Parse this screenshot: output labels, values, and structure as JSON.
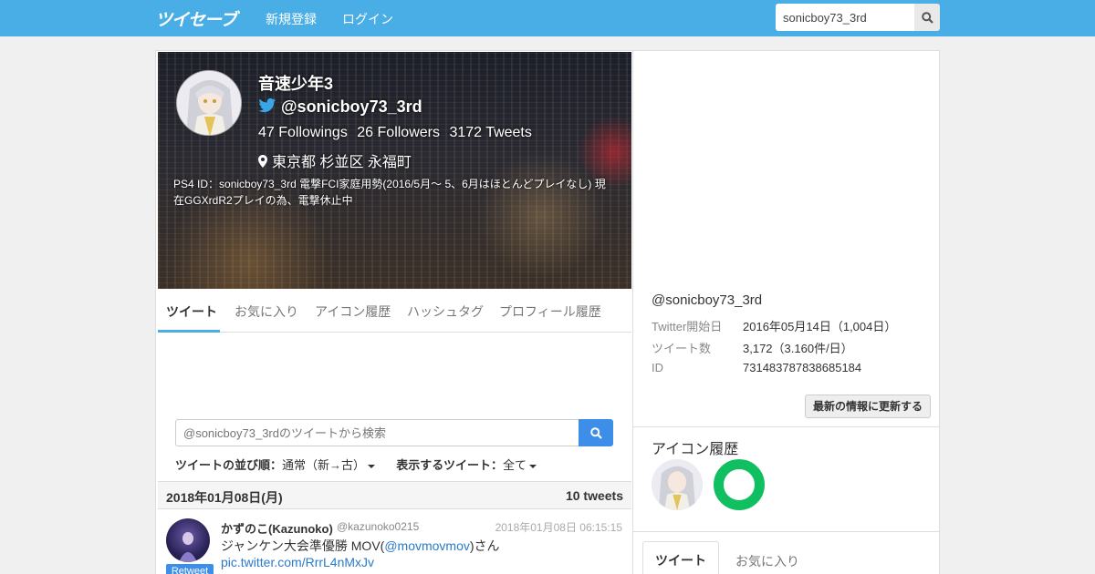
{
  "navbar": {
    "logo": "ツイセーブ",
    "signup": "新規登録",
    "login": "ログイン",
    "search_value": "sonicboy73_3rd"
  },
  "profile": {
    "name": "音速少年3",
    "handle": "@sonicboy73_3rd",
    "followings": "47 Followings",
    "followers": "26 Followers",
    "tweets": "3172 Tweets",
    "location": "東京都 杉並区 永福町",
    "bio": "PS4 ID：sonicboy73_3rd 電撃FCI家庭用勢(2016/5月～ 5、6月はほとんどプレイなし) 現在GGXrdR2プレイの為、電撃休止中"
  },
  "tabs": [
    "ツイート",
    "お気に入り",
    "アイコン履歴",
    "ハッシュタグ",
    "プロフィール履歴"
  ],
  "tweet_search": {
    "placeholder": "@sonicboy73_3rdのツイートから検索"
  },
  "sort": {
    "label": "ツイートの並び順：",
    "value": "通常（新→古）",
    "filter_label": "表示するツイート：",
    "filter_value": "全て"
  },
  "day_header": {
    "date": "2018年01月08日(月)",
    "count": "10 tweets"
  },
  "tweet": {
    "name": "かずのこ(Kazunoko)",
    "username": "@kazunoko0215",
    "time": "2018年01月08日 06:15:15",
    "badge": "Retweet",
    "text_1": "ジャンケン大会準優勝 MOV(",
    "link_1": "@movmovmov",
    "text_2": ")さん ",
    "link_2": "pic.twitter.com/RrrL4nMxJv"
  },
  "sidebar": {
    "handle": "@sonicboy73_3rd",
    "rows": [
      {
        "key": "Twitter開始日",
        "value": "2016年05月14日（1,004日）"
      },
      {
        "key": "ツイート数",
        "value": "3,172（3.160件/日）"
      },
      {
        "key": "ID",
        "value": "731483787838685184"
      }
    ],
    "update_button": "最新の情報に更新する",
    "icon_history_title": "アイコン履歴",
    "tab_active": "ツイート",
    "tab_other": "お気に入り"
  },
  "colors": {
    "navbar": "#4aaee6",
    "accent": "#3d8ee8",
    "link": "#2a7ac9"
  }
}
